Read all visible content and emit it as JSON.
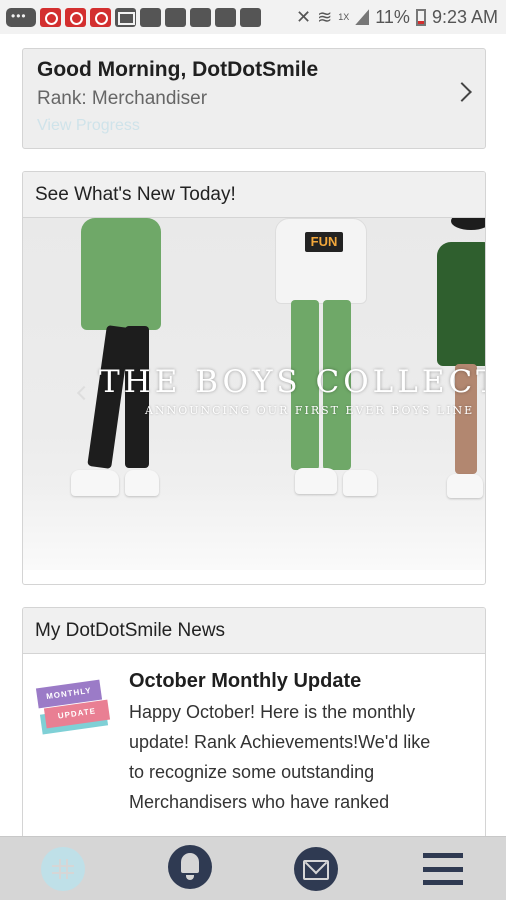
{
  "status_bar": {
    "battery": "11%",
    "time": "9:23 AM",
    "network": "1X"
  },
  "greeting": {
    "title": "Good Morning, DotDotSmile",
    "rank": "Rank: Merchandiser",
    "link": "View Progress"
  },
  "promo": {
    "header": "See What's New Today!",
    "banner_title": "THE BOYS COLLECTIO",
    "banner_subtitle": "ANNOUNCING OUR FIRST EVER BOYS LINE",
    "shirt_print": "FUN"
  },
  "news": {
    "header": "My DotDotSmile News",
    "thumb_line1": "MONTHLY",
    "thumb_line2": "UPDATE",
    "item_title": "October Monthly Update",
    "item_desc": " Happy October! Here is the monthly update!   Rank Achievements!We'd like to recognize some outstanding Merchandisers who have ranked"
  },
  "nav": {
    "items": [
      "grid-icon",
      "bell-icon",
      "mail-icon",
      "menu-icon"
    ]
  },
  "colors": {
    "accent_dark": "#2f3a52",
    "accent_light": "#bfe0e8",
    "link": "#cfe3ea"
  }
}
